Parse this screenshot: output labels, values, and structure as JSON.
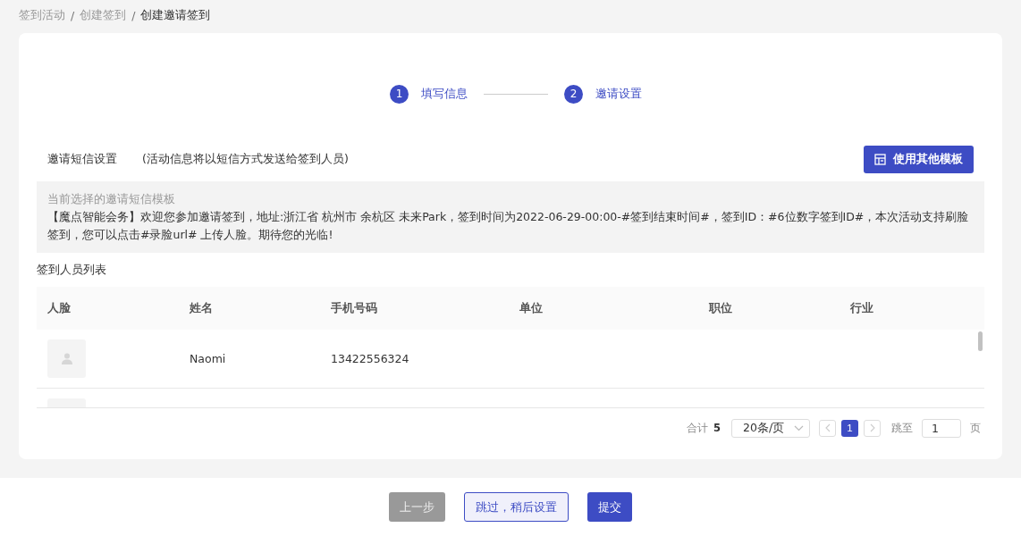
{
  "breadcrumb": [
    {
      "label": "签到活动",
      "current": false
    },
    {
      "label": "创建签到",
      "current": false
    },
    {
      "label": "创建邀请签到",
      "current": true
    }
  ],
  "breadcrumb_separator": "/",
  "steps": [
    {
      "number": "1",
      "label": "填写信息"
    },
    {
      "number": "2",
      "label": "邀请设置"
    }
  ],
  "sms": {
    "title": "邀请短信设置",
    "note": "(活动信息将以短信方式发送给签到人员)",
    "template_button": "使用其他模板",
    "template_caption": "当前选择的邀请短信模板",
    "template_text": "【魔点智能会务】欢迎您参加邀请签到，地址:浙江省 杭州市 余杭区 未来Park，签到时间为2022-06-29-00:00-#签到结束时间#，签到ID：#6位数字签到ID#，本次活动支持刷脸签到，您可以点击#录脸url# 上传人脸。期待您的光临!"
  },
  "table": {
    "title": "签到人员列表",
    "columns": [
      "人脸",
      "姓名",
      "手机号码",
      "单位",
      "职位",
      "行业"
    ],
    "rows": [
      {
        "kind": "full",
        "name": "Naomi",
        "phone": "13422556324"
      },
      {
        "kind": "clipped"
      }
    ]
  },
  "pagination": {
    "total_label": "合计",
    "total": "5",
    "page_size": "20条/页",
    "pages": [
      {
        "label": "1",
        "selected": true
      }
    ],
    "prev_disabled": true,
    "next_disabled": true,
    "jump_label": "跳至",
    "jump_value": "1",
    "page_unit": "页"
  },
  "footer_buttons": [
    {
      "label": "上一步",
      "kind": "disabled"
    },
    {
      "label": "跳过，稍后设置",
      "kind": "outline"
    },
    {
      "label": "提交",
      "kind": "primary"
    }
  ]
}
